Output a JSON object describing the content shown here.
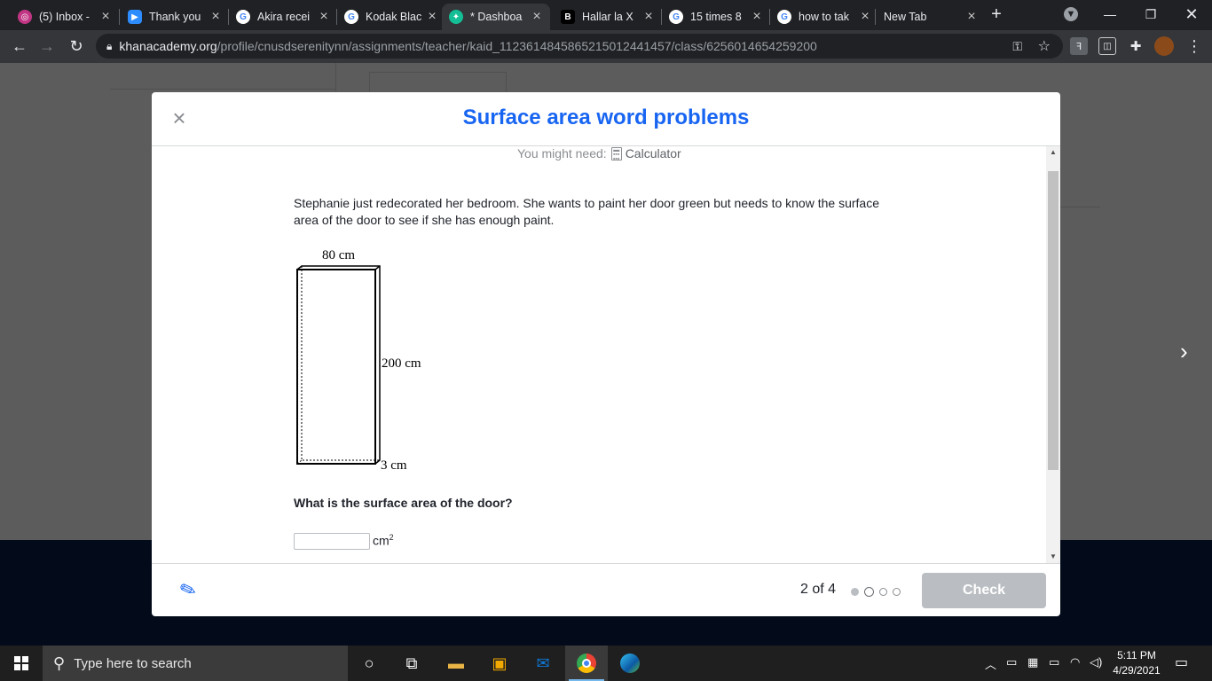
{
  "browser": {
    "tabs": [
      {
        "title": "(5) Inbox -",
        "icon": "instagram-icon",
        "color": "#c13584"
      },
      {
        "title": "Thank you",
        "icon": "zoom-icon",
        "color": "#2d8cff"
      },
      {
        "title": "Akira recei",
        "icon": "google-icon",
        "color": "#ffffff"
      },
      {
        "title": "Kodak Blac",
        "icon": "google-icon",
        "color": "#ffffff"
      },
      {
        "title": "* Dashboa",
        "icon": "khan-academy-icon",
        "color": "#14bf96"
      },
      {
        "title": "Hallar la X",
        "icon": "brainly-icon",
        "color": "#000000"
      },
      {
        "title": "15 times 8",
        "icon": "google-icon",
        "color": "#ffffff"
      },
      {
        "title": "how to tak",
        "icon": "google-icon",
        "color": "#ffffff"
      },
      {
        "title": "New Tab",
        "icon": "",
        "color": ""
      }
    ],
    "url_host": "khanacademy.org",
    "url_path": "/profile/cnusdserenitynn/assignments/teacher/kaid_1123614845865215012441457/class/6256014654259200"
  },
  "modal": {
    "title": "Surface area word problems",
    "might_need": "You might need:",
    "calculator": "Calculator",
    "problem_text": "Stephanie just redecorated her bedroom. She wants to paint her door green but needs to know the surface area of the door to see if she has enough paint.",
    "figure": {
      "width_label": "80 cm",
      "height_label": "200 cm",
      "depth_label": "3 cm"
    },
    "question": "What is the surface area of the door?",
    "answer_value": "",
    "unit": "cm",
    "unit_exp": "2",
    "progress": "2 of 4",
    "dots": 4,
    "current": 2,
    "check_label": "Check"
  },
  "taskbar": {
    "search_placeholder": "Type here to search",
    "time": "5:11 PM",
    "date": "4/29/2021"
  }
}
